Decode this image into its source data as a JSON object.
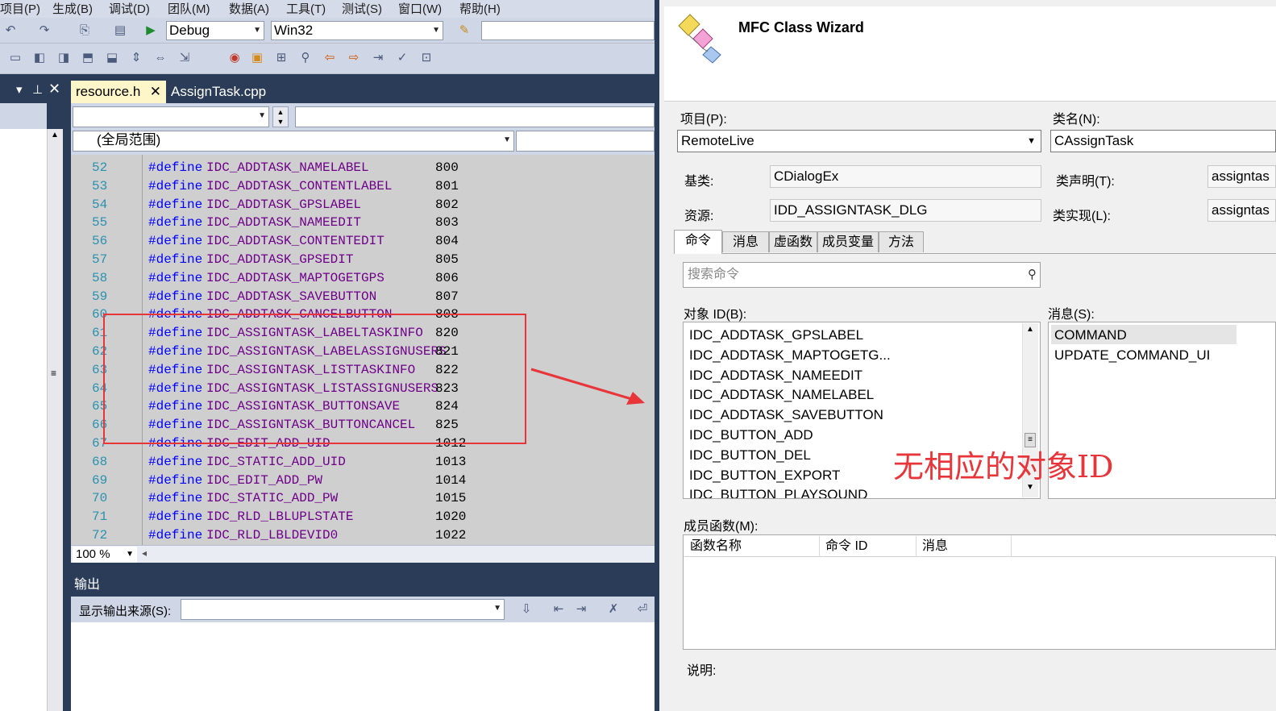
{
  "menu": [
    "项目(P)",
    "生成(B)",
    "调试(D)",
    "团队(M)",
    "数据(A)",
    "工具(T)",
    "测试(S)",
    "窗口(W)",
    "帮助(H)"
  ],
  "toolbar": {
    "config": "Debug",
    "platform": "Win32"
  },
  "tabs": {
    "resource": "resource.h",
    "assign": "AssignTask.cpp"
  },
  "nav": {
    "scope": "(全局范围)"
  },
  "code_lines": [
    {
      "ln": "52",
      "kw": "#define",
      "name": "IDC_ADDTASK_NAMELABEL",
      "val": "800"
    },
    {
      "ln": "53",
      "kw": "#define",
      "name": "IDC_ADDTASK_CONTENTLABEL",
      "val": "801"
    },
    {
      "ln": "54",
      "kw": "#define",
      "name": "IDC_ADDTASK_GPSLABEL",
      "val": "802"
    },
    {
      "ln": "55",
      "kw": "#define",
      "name": "IDC_ADDTASK_NAMEEDIT",
      "val": "803"
    },
    {
      "ln": "56",
      "kw": "#define",
      "name": "IDC_ADDTASK_CONTENTEDIT",
      "val": "804"
    },
    {
      "ln": "57",
      "kw": "#define",
      "name": "IDC_ADDTASK_GPSEDIT",
      "val": "805"
    },
    {
      "ln": "58",
      "kw": "#define",
      "name": "IDC_ADDTASK_MAPTOGETGPS",
      "val": "806"
    },
    {
      "ln": "59",
      "kw": "#define",
      "name": "IDC_ADDTASK_SAVEBUTTON",
      "val": "807"
    },
    {
      "ln": "60",
      "kw": "#define",
      "name": "IDC_ADDTASK_CANCELBUTTON",
      "val": "808"
    },
    {
      "ln": "61",
      "kw": "#define",
      "name": "IDC_ASSIGNTASK_LABELTASKINFO",
      "val": "820"
    },
    {
      "ln": "62",
      "kw": "#define",
      "name": "IDC_ASSIGNTASK_LABELASSIGNUSERS",
      "val": "821"
    },
    {
      "ln": "63",
      "kw": "#define",
      "name": "IDC_ASSIGNTASK_LISTTASKINFO",
      "val": "822"
    },
    {
      "ln": "64",
      "kw": "#define",
      "name": "IDC_ASSIGNTASK_LISTASSIGNUSERS",
      "val": "823"
    },
    {
      "ln": "65",
      "kw": "#define",
      "name": "IDC_ASSIGNTASK_BUTTONSAVE",
      "val": "824"
    },
    {
      "ln": "66",
      "kw": "#define",
      "name": "IDC_ASSIGNTASK_BUTTONCANCEL",
      "val": "825"
    },
    {
      "ln": "67",
      "kw": "#define",
      "name": "IDC_EDIT_ADD_UID",
      "val": "1012"
    },
    {
      "ln": "68",
      "kw": "#define",
      "name": "IDC_STATIC_ADD_UID",
      "val": "1013"
    },
    {
      "ln": "69",
      "kw": "#define",
      "name": "IDC_EDIT_ADD_PW",
      "val": "1014"
    },
    {
      "ln": "70",
      "kw": "#define",
      "name": "IDC_STATIC_ADD_PW",
      "val": "1015"
    },
    {
      "ln": "71",
      "kw": "#define",
      "name": "IDC_RLD_LBLUPLSTATE",
      "val": "1020"
    },
    {
      "ln": "72",
      "kw": "#define",
      "name": "IDC_RLD_LBLDEVID0",
      "val": "1022"
    }
  ],
  "zoom": "100 %",
  "output": {
    "title": "输出",
    "source_label": "显示输出来源(S):"
  },
  "wizard": {
    "title": "MFC Class Wizard",
    "project_label": "项目(P):",
    "project": "RemoteLive",
    "classname_label": "类名(N):",
    "classname": "CAssignTask",
    "base_label": "基类:",
    "base": "CDialogEx",
    "decl_label": "类声明(T):",
    "decl": "assigntas",
    "resource_label": "资源:",
    "resource": "IDD_ASSIGNTASK_DLG",
    "impl_label": "类实现(L):",
    "impl": "assigntas",
    "tabs": [
      "命令",
      "消息",
      "虚函数",
      "成员变量",
      "方法"
    ],
    "search_placeholder": "搜索命令",
    "objects_label": "对象 ID(B):",
    "objects": [
      "IDC_ADDTASK_GPSLABEL",
      "IDC_ADDTASK_MAPTOGETG...",
      "IDC_ADDTASK_NAMEEDIT",
      "IDC_ADDTASK_NAMELABEL",
      "IDC_ADDTASK_SAVEBUTTON",
      "IDC_BUTTON_ADD",
      "IDC_BUTTON_DEL",
      "IDC_BUTTON_EXPORT",
      "IDC_BUTTON_PLAYSOUND"
    ],
    "messages_label": "消息(S):",
    "messages": [
      "COMMAND",
      "UPDATE_COMMAND_UI"
    ],
    "members_label": "成员函数(M):",
    "columns": [
      "函数名称",
      "命令 ID",
      "消息"
    ],
    "desc_label": "说明:"
  },
  "annotation": "无相应的对象ID",
  "colors": {
    "highlight_box": "#e8353a",
    "active_tab": "#fef5c9",
    "ide_background": "#2b3c59"
  }
}
